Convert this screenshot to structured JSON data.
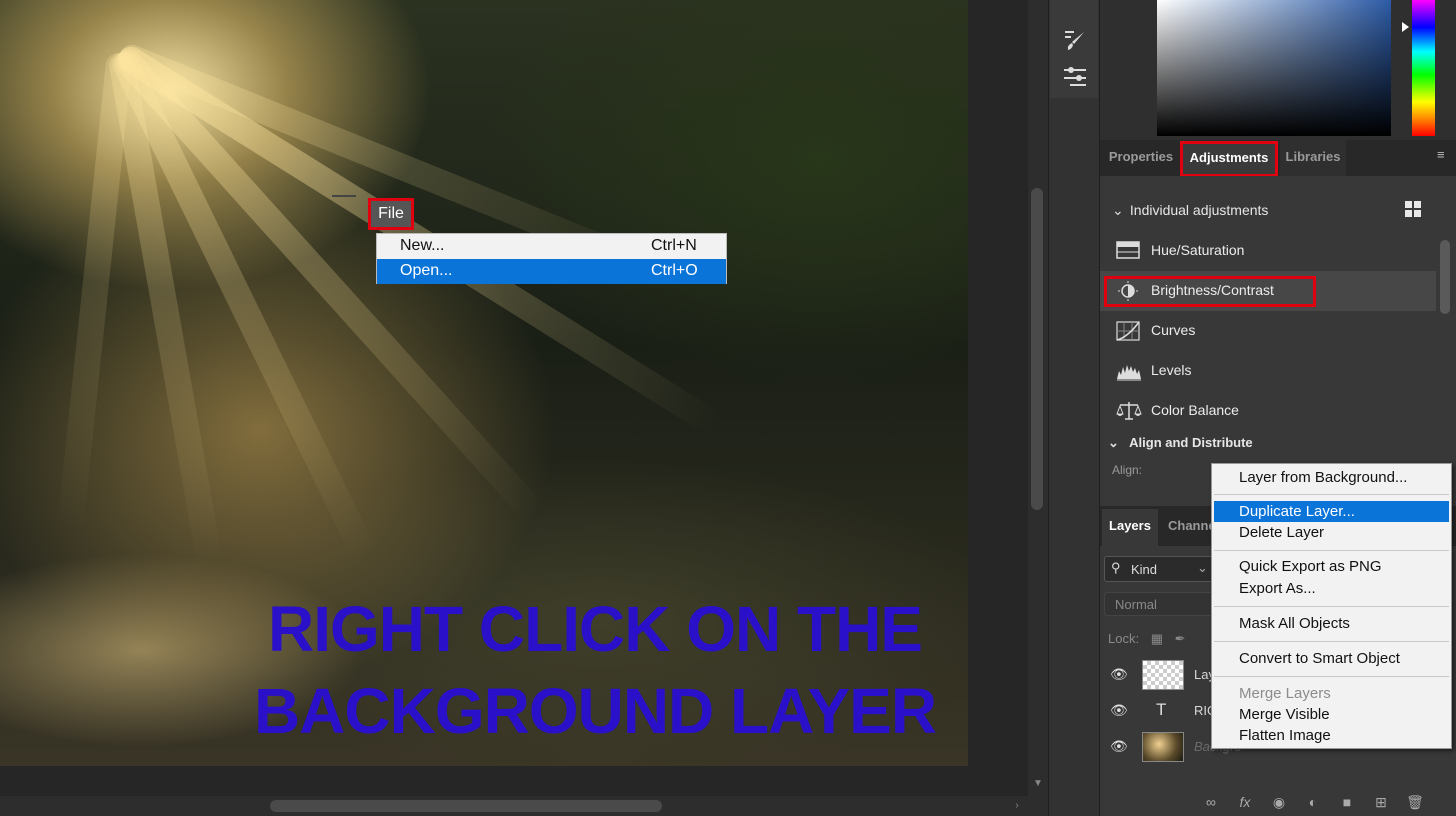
{
  "canvas": {
    "overlay_text_line1": "RIGHT CLICK ON THE",
    "overlay_text_line2": "BACKGROUND LAYER",
    "overlay_text_color": "#2a10c8"
  },
  "file_menu": {
    "button_label": "File",
    "items": [
      {
        "label": "New...",
        "shortcut": "Ctrl+N",
        "selected": false
      },
      {
        "label": "Open...",
        "shortcut": "Ctrl+O",
        "selected": true
      }
    ]
  },
  "adjustments_panel": {
    "tabs": [
      "Properties",
      "Adjustments",
      "Libraries"
    ],
    "active_tab": "Adjustments",
    "section_individual": "Individual adjustments",
    "items": [
      {
        "label": "Hue/Saturation",
        "icon": "hue-saturation-icon"
      },
      {
        "label": "Brightness/Contrast",
        "icon": "brightness-contrast-icon"
      },
      {
        "label": "Curves",
        "icon": "curves-icon"
      },
      {
        "label": "Levels",
        "icon": "levels-icon"
      },
      {
        "label": "Color Balance",
        "icon": "color-balance-icon"
      }
    ],
    "section_align": "Align and Distribute",
    "align_label": "Align:"
  },
  "layers_panel": {
    "tabs": [
      "Layers",
      "Channe"
    ],
    "kind_filter": "Kind",
    "blend_mode": "Normal",
    "lock_label": "Lock:",
    "layers": [
      {
        "name": "Lay",
        "type": "pixel"
      },
      {
        "name": "RIG",
        "type": "text"
      },
      {
        "name": "Backgro",
        "type": "background"
      }
    ]
  },
  "context_menu": {
    "groups": [
      [
        "Layer from Background..."
      ],
      [
        "Duplicate Layer...",
        "Delete Layer"
      ],
      [
        "Quick Export as PNG",
        "Export As..."
      ],
      [
        "Mask All Objects"
      ],
      [
        "Convert to Smart Object"
      ],
      [
        "Merge Layers",
        "Merge Visible",
        "Flatten Image"
      ]
    ],
    "selected": "Duplicate Layer...",
    "disabled": [
      "Merge Layers"
    ]
  },
  "colors": {
    "highlight_red": "#e00010",
    "menu_select_blue": "#0a74d8"
  }
}
